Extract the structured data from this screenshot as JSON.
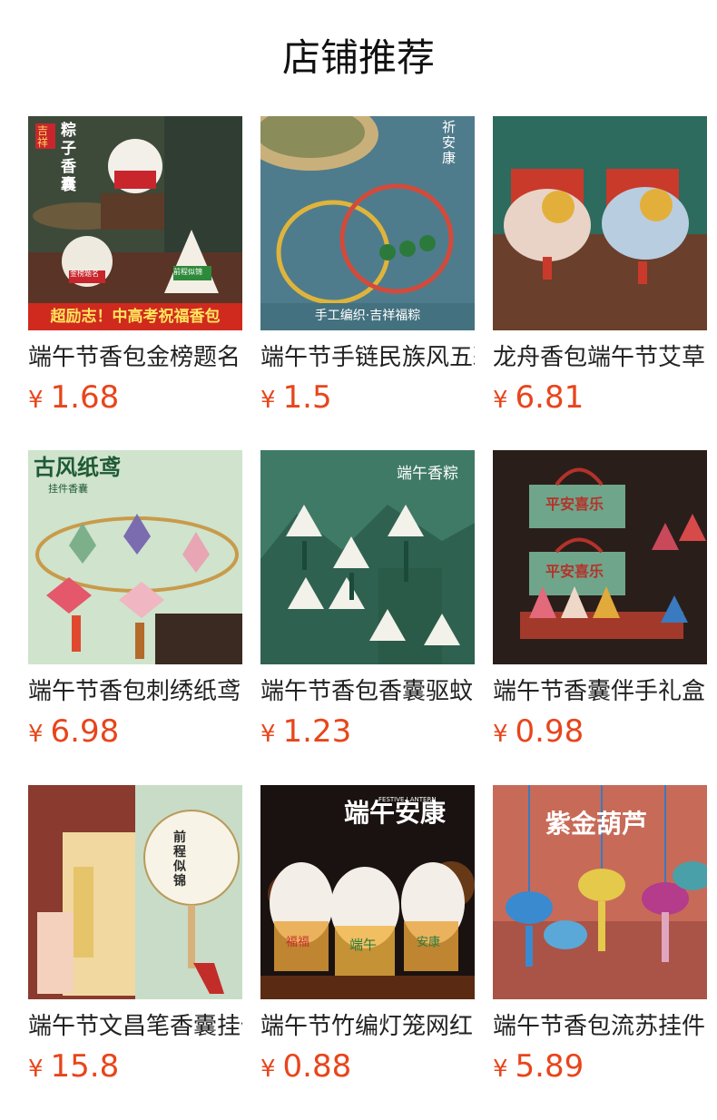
{
  "header": {
    "title": "店铺推荐"
  },
  "currency_symbol": "¥",
  "products": [
    {
      "name": "端午节香包金榜题名",
      "price": "1.68",
      "image_text": [
        "粽子香囊",
        "吉祥",
        "金榜题名",
        "前程似锦",
        "超励志！中高考祝福香包"
      ]
    },
    {
      "name": "端午节手链民族风五彩绳",
      "price": "1.5",
      "image_text": [
        "祈安康",
        "手工编织·吉祥福粽"
      ]
    },
    {
      "name": "龙舟香包端午节艾草",
      "price": "6.81",
      "image_text": []
    },
    {
      "name": "端午节香包刺绣纸鸢",
      "price": "6.98",
      "image_text": [
        "古风纸鸢",
        "挂件香囊"
      ]
    },
    {
      "name": "端午节香包香囊驱蚊",
      "price": "1.23",
      "image_text": [
        "端午香粽"
      ]
    },
    {
      "name": "端午节香囊伴手礼盒",
      "price": "0.98",
      "image_text": [
        "平安喜乐",
        "平安喜乐"
      ]
    },
    {
      "name": "端午节文昌笔香囊挂件",
      "price": "15.8",
      "image_text": [
        "前程似锦"
      ]
    },
    {
      "name": "端午节竹编灯笼网红",
      "price": "0.88",
      "image_text": [
        "端午安康",
        "FESTIVE LANTERN",
        "福福",
        "端午",
        "安康"
      ]
    },
    {
      "name": "端午节香包流苏挂件",
      "price": "5.89",
      "image_text": [
        "紫金葫芦"
      ]
    }
  ]
}
